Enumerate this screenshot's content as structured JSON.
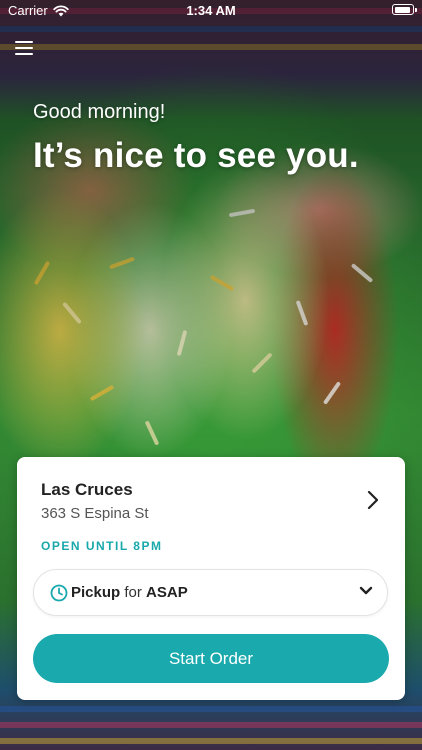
{
  "status_bar": {
    "carrier": "Carrier",
    "time": "1:34 AM"
  },
  "header": {
    "greeting": "Good morning!",
    "headline": "It’s nice to see you."
  },
  "location": {
    "name": "Las Cruces",
    "address": "363 S Espina St",
    "hours": "OPEN UNTIL 8PM"
  },
  "order_mode": {
    "mode": "Pickup",
    "connector": "for",
    "time": "ASAP"
  },
  "actions": {
    "start_order_label": "Start Order"
  },
  "colors": {
    "accent": "#1aa9ad"
  },
  "icons": [
    "wifi-icon",
    "battery-icon",
    "menu-icon",
    "chevron-right-icon",
    "clock-icon",
    "chevron-down-icon"
  ]
}
